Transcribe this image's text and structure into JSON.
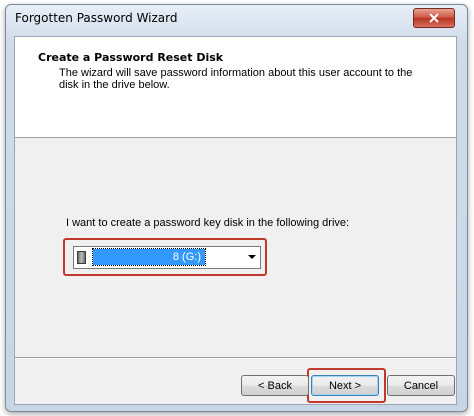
{
  "window": {
    "title": "Forgotten Password Wizard",
    "close_icon": "close-icon"
  },
  "header": {
    "title": "Create a Password Reset Disk",
    "description": "The wizard will save password information about this user account to the disk in the drive below."
  },
  "body": {
    "prompt": "I want to create a password key disk in the following drive:",
    "drive_select": {
      "icon": "removable-drive-icon",
      "selected": "8 (G:)"
    }
  },
  "buttons": {
    "back": "< Back",
    "next": "Next >",
    "cancel": "Cancel"
  },
  "colors": {
    "highlight_callout": "#c0392b",
    "selection": "#3399ff"
  }
}
